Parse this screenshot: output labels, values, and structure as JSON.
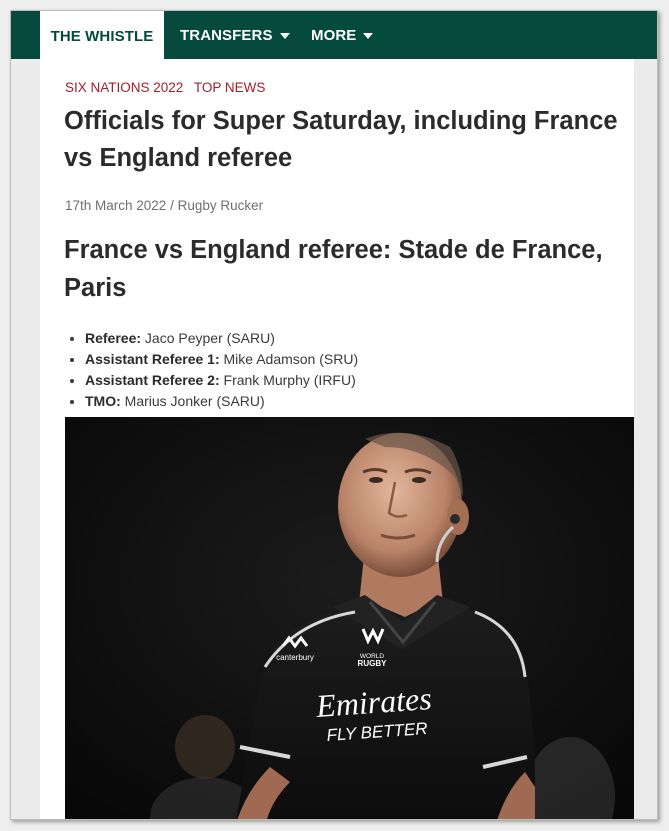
{
  "nav": {
    "home_label": "THE WHISTLE",
    "transfers_label": "TRANSFERS",
    "more_label": "MORE"
  },
  "article": {
    "categories": [
      "SIX NATIONS 2022",
      "TOP NEWS"
    ],
    "title": "Officials for Super Saturday, including France vs England referee",
    "date": "17th March 2022",
    "separator": " / ",
    "author": "Rugby Rucker",
    "subheading": "France vs England referee: Stade de France, Paris",
    "officials": [
      {
        "role": "Referee:",
        "name": "Jaco Peyper (SARU)"
      },
      {
        "role": "Assistant Referee 1:",
        "name": "Mike Adamson (SRU)"
      },
      {
        "role": "Assistant Referee 2:",
        "name": "Frank Murphy (IRFU)"
      },
      {
        "role": "TMO:",
        "name": "Marius Jonker (SARU)"
      }
    ],
    "photo": {
      "brand_canterbury": "canterbury",
      "brand_world": "WORLD",
      "brand_rugby": "RUGBY",
      "sponsor_line1": "Emirates",
      "sponsor_line2": "FLY BETTER"
    }
  },
  "colors": {
    "nav_bg": "#064a3e",
    "category": "#a31f2b",
    "heading": "#2b2b2b"
  }
}
